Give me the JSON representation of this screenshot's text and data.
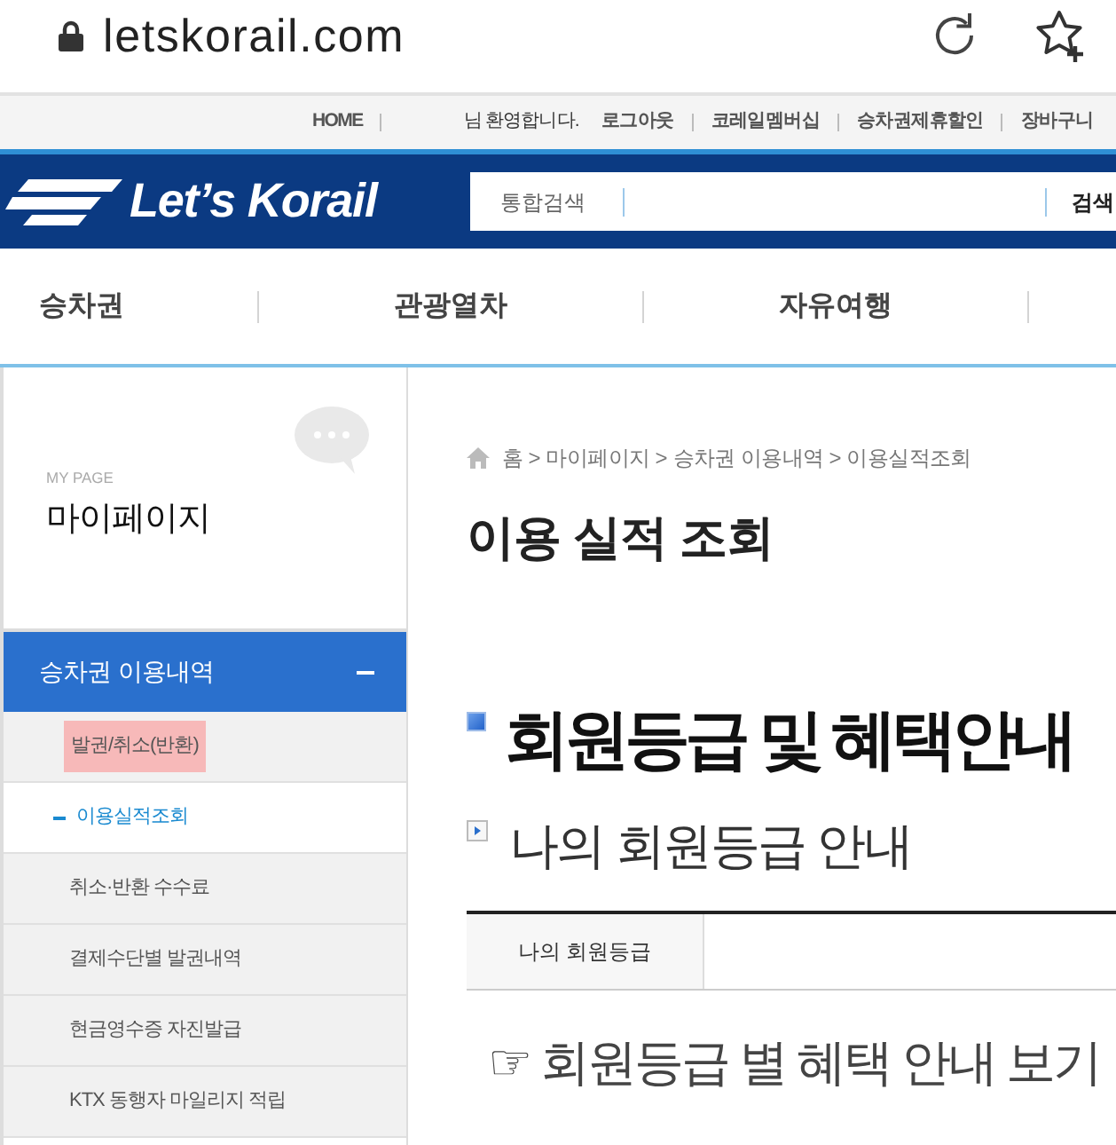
{
  "browser": {
    "url": "letskorail.com"
  },
  "util_bar": [
    {
      "kind": "link",
      "label": "HOME"
    },
    {
      "kind": "text",
      "label": "님 환영합니다."
    },
    {
      "kind": "link",
      "label": "로그아웃"
    },
    {
      "kind": "link",
      "label": "코레일멤버십"
    },
    {
      "kind": "link",
      "label": "승차권제휴할인"
    },
    {
      "kind": "link",
      "label": "장바구니"
    }
  ],
  "header": {
    "logo": "Let’s Korail",
    "search": {
      "label": "통합검색",
      "button": "검색"
    }
  },
  "nav": [
    {
      "label": "승차권"
    },
    {
      "label": "관광열차"
    },
    {
      "label": "자유여행"
    }
  ],
  "sidebar": {
    "eyebrow": "MY PAGE",
    "title": "마이페이지",
    "menu": {
      "label": "승차권 이용내역",
      "expanded": true,
      "children": [
        {
          "label": "발권/취소(반환)",
          "selected": false,
          "highlighted": true
        },
        {
          "label": "이용실적조회",
          "selected": true,
          "highlighted": false
        },
        {
          "label": "취소·반환 수수료",
          "selected": false,
          "highlighted": false
        },
        {
          "label": "결제수단별 발권내역",
          "selected": false,
          "highlighted": false
        },
        {
          "label": "현금영수증 자진발급",
          "selected": false,
          "highlighted": false
        },
        {
          "label": "KTX 동행자 마일리지 적립",
          "selected": false,
          "highlighted": false
        }
      ]
    }
  },
  "breadcrumb": [
    {
      "kind": "home",
      "label": "홈"
    },
    {
      "kind": "separator",
      "label": ">"
    },
    {
      "kind": "link",
      "label": "마이페이지"
    },
    {
      "kind": "separator",
      "label": ">"
    },
    {
      "kind": "link",
      "label": "승차권 이용내역"
    },
    {
      "kind": "separator",
      "label": ">"
    },
    {
      "kind": "link",
      "label": "이용실적조회"
    }
  ],
  "page_title": "이용 실적 조회",
  "section": {
    "title": "회원등급 및 혜택안내",
    "subtitle": "나의 회원등급 안내",
    "table": {
      "rows": [
        {
          "label": "나의 회원등급"
        }
      ]
    },
    "link": "☞ 회원등급 별 혜택 안내 보기"
  }
}
